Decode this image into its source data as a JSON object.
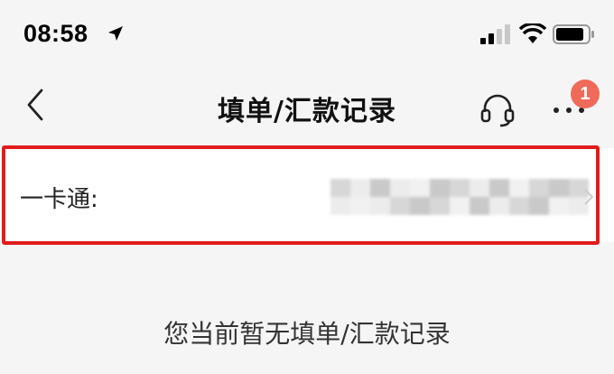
{
  "status_bar": {
    "time": "08:58",
    "icons": [
      "location-arrow-icon",
      "signal-icon",
      "wifi-icon",
      "battery-icon"
    ]
  },
  "nav": {
    "title": "填单/汇款记录",
    "back_icon": "chevron-left-icon",
    "service_icon": "headset-icon",
    "more_icon": "more-dots-icon",
    "badge_count": "1"
  },
  "card": {
    "label": "一卡通:",
    "value_blurred": true,
    "highlight_color": "#e11c1c"
  },
  "empty_state": {
    "message": "您当前暂无填单/汇款记录"
  },
  "colors": {
    "background": "#f5f5f5",
    "badge": "#f06a5a",
    "highlight": "#e11c1c"
  }
}
